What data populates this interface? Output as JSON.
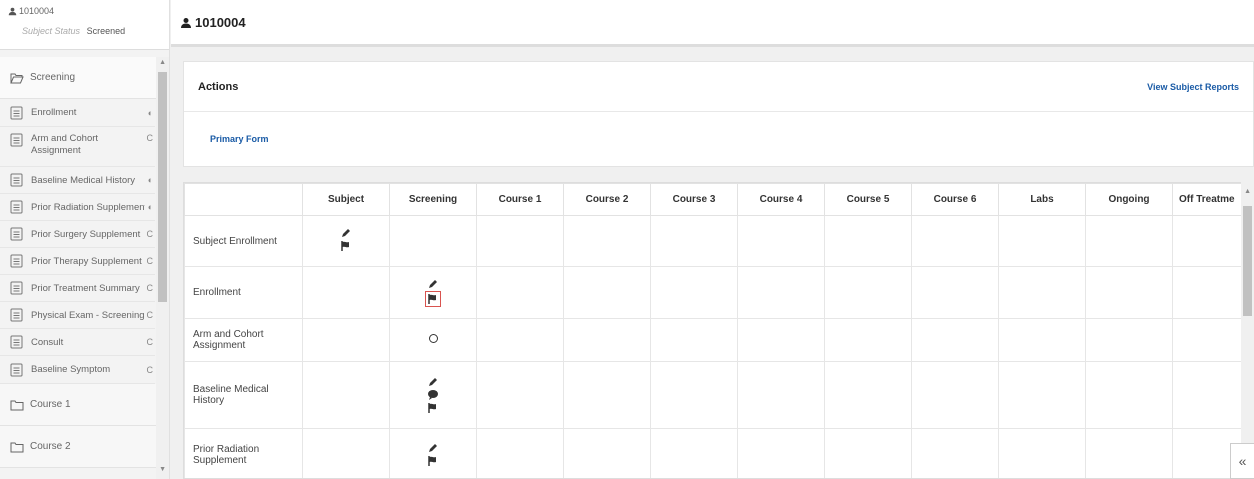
{
  "sidebar": {
    "subject_id": "1010004",
    "status_label": "Subject Status",
    "status_value": "Screened",
    "folders": {
      "screening": "Screening",
      "course1": "Course 1",
      "course2": "Course 2"
    },
    "items": [
      {
        "label": "Enrollment",
        "status": "◐"
      },
      {
        "label": "Arm and Cohort Assignment",
        "status": "C"
      },
      {
        "label": "Baseline Medical History",
        "status": "◐"
      },
      {
        "label": "Prior Radiation Supplement",
        "status": "◐"
      },
      {
        "label": "Prior Surgery Supplement",
        "status": "C"
      },
      {
        "label": "Prior Therapy Supplement",
        "status": "C"
      },
      {
        "label": "Prior Treatment Summary",
        "status": "C"
      },
      {
        "label": "Physical Exam - Screening",
        "status": "C"
      },
      {
        "label": "Consult",
        "status": "C"
      },
      {
        "label": "Baseline Symptom",
        "status": "C"
      }
    ]
  },
  "header": {
    "title": "1010004"
  },
  "actions": {
    "title": "Actions",
    "view_reports": "View Subject Reports",
    "primary_form": "Primary Form"
  },
  "grid": {
    "columns": [
      "Subject",
      "Screening",
      "Course 1",
      "Course 2",
      "Course 3",
      "Course 4",
      "Course 5",
      "Course 6",
      "Labs",
      "Ongoing",
      "Off Treatme"
    ],
    "rows": [
      {
        "label": "Subject Enrollment"
      },
      {
        "label": "Enrollment"
      },
      {
        "label": "Arm and Cohort Assignment"
      },
      {
        "label": "Baseline Medical History"
      },
      {
        "label": "Prior Radiation Supplement"
      }
    ]
  },
  "icons": [
    "user-icon",
    "folder-open-icon",
    "folder-icon",
    "document-icon",
    "pencil-icon",
    "flag-icon",
    "comment-icon",
    "circle-icon",
    "collapse-icon"
  ]
}
